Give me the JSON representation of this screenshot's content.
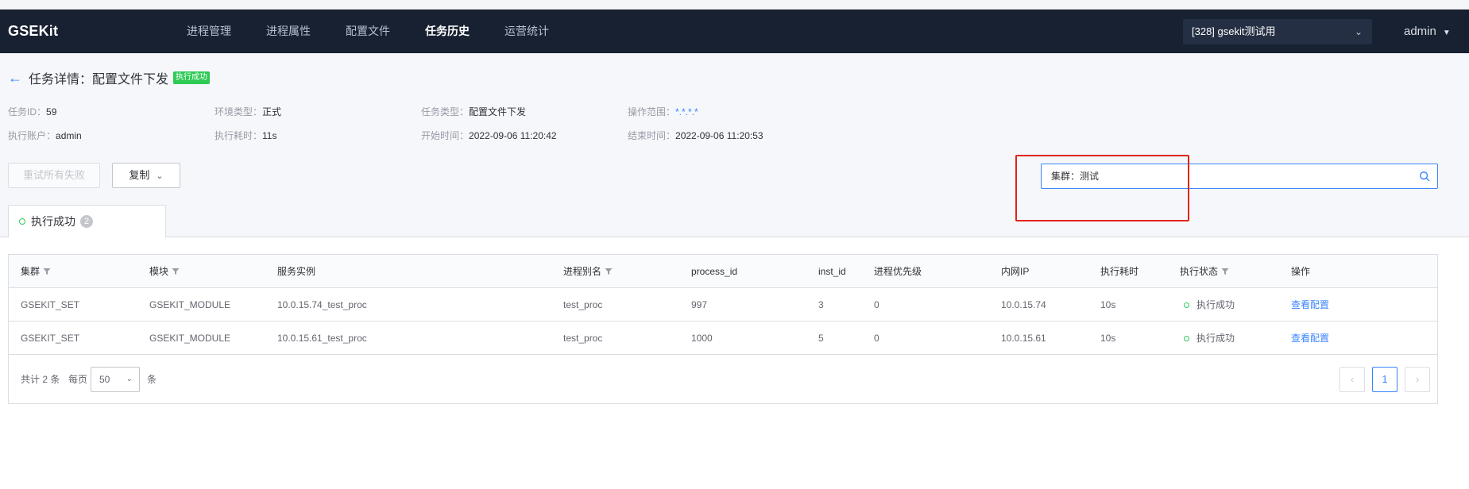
{
  "app": {
    "brand": "GSEKit"
  },
  "nav": {
    "items": [
      {
        "label": "进程管理"
      },
      {
        "label": "进程属性"
      },
      {
        "label": "配置文件"
      },
      {
        "label": "任务历史"
      },
      {
        "label": "运营统计"
      }
    ],
    "active": "任务历史",
    "business_select": "[328] gsekit测试用",
    "user": "admin"
  },
  "page": {
    "title": "任务详情：配置文件下发",
    "status_tag": "执行成功"
  },
  "info": {
    "task_id_label": "任务ID：",
    "task_id": "59",
    "env_label": "环境类型：",
    "env": "正式",
    "task_type_label": "任务类型：",
    "task_type": "配置文件下发",
    "scope_label": "操作范围：",
    "scope": "*.*.*.*",
    "account_label": "执行账户：",
    "account": "admin",
    "duration_label": "执行耗时：",
    "duration": "11s",
    "start_label": "开始时间：",
    "start": "2022-09-06 11:20:42",
    "end_label": "结束时间：",
    "end": "2022-09-06 11:20:53"
  },
  "toolbar": {
    "retry_label": "重试所有失败",
    "copy_label": "复制",
    "search_value": "集群：测试"
  },
  "tabs": [
    {
      "label": "执行成功",
      "count": "2"
    }
  ],
  "table": {
    "columns": [
      "集群",
      "模块",
      "服务实例",
      "进程别名",
      "process_id",
      "inst_id",
      "进程优先级",
      "内网IP",
      "执行耗时",
      "执行状态",
      "操作"
    ],
    "rows": [
      {
        "cluster": "GSEKIT_SET",
        "module": "GSEKIT_MODULE",
        "instance": "10.0.15.74_test_proc",
        "alias": "test_proc",
        "process_id": "997",
        "inst_id": "3",
        "priority": "0",
        "ip": "10.0.15.74",
        "duration": "10s",
        "status": "执行成功",
        "action": "查看配置"
      },
      {
        "cluster": "GSEKIT_SET",
        "module": "GSEKIT_MODULE",
        "instance": "10.0.15.61_test_proc",
        "alias": "test_proc",
        "process_id": "1000",
        "inst_id": "5",
        "priority": "0",
        "ip": "10.0.15.61",
        "duration": "10s",
        "status": "执行成功",
        "action": "查看配置"
      }
    ]
  },
  "pagination": {
    "total_prefix": "共计",
    "total": "2",
    "total_suffix": "条",
    "per_page_label": "每页",
    "page_size": "50",
    "unit": "条",
    "current_page": "1"
  },
  "colors": {
    "nav_bg": "#182132",
    "accent": "#3a84ff",
    "success": "#2dcb56",
    "highlight": "#e1251b"
  },
  "icons": {
    "back": "arrow-left-icon",
    "search": "search-icon",
    "filter": "filter-icon",
    "chevron": "chevron-down-icon",
    "prev": "chevron-left-icon",
    "next": "chevron-right-icon"
  }
}
